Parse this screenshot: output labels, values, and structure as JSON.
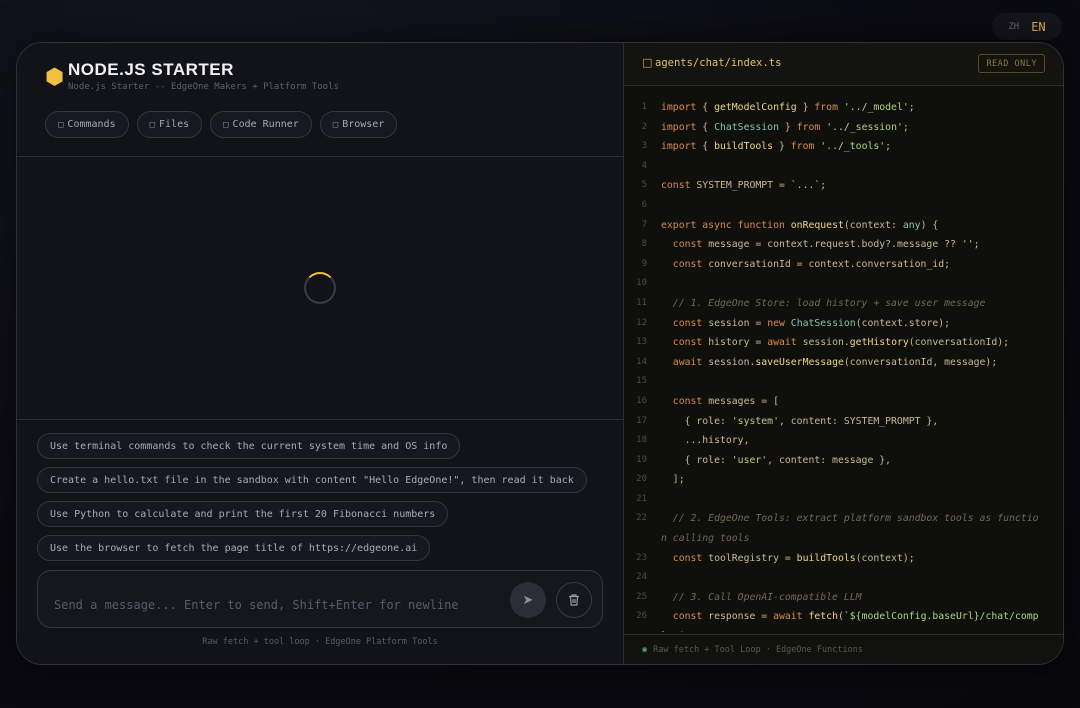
{
  "lang": {
    "zh": "ZH",
    "en": "EN"
  },
  "header": {
    "title": "NODE.JS STARTER",
    "subtitle": "Node.js Starter -- EdgeOne Makers + Platform Tools",
    "tabs": [
      {
        "label": "Commands",
        "icon": "terminal-icon"
      },
      {
        "label": "Files",
        "icon": "file-icon"
      },
      {
        "label": "Code Runner",
        "icon": "code-icon"
      },
      {
        "label": "Browser",
        "icon": "globe-icon"
      }
    ]
  },
  "suggestions": [
    "Use terminal commands to check the current system time and OS info",
    "Create a hello.txt file in the sandbox with content \"Hello EdgeOne!\", then read it back",
    "Use Python to calculate and print the first 20 Fibonacci numbers",
    "Use the browser to fetch the page title of https://edgeone.ai"
  ],
  "input": {
    "placeholder": "Send a message... Enter to send, Shift+Enter for newline",
    "value": ""
  },
  "left_footer": "Raw fetch + tool loop · EdgeOne Platform Tools",
  "code_panel": {
    "file_path": "agents/chat/index.ts",
    "badge": "READ ONLY",
    "footer": "Raw fetch + Tool Loop · EdgeOne Functions",
    "lines": [
      {
        "n": "1",
        "html": "<span class='kw'>import</span> { <span class='fn'>getModelConfig</span> } <span class='kw'>from</span> <span class='str'>'../_model'</span>;"
      },
      {
        "n": "2",
        "html": "<span class='kw'>import</span> { <span class='ty'>ChatSession</span> } <span class='kw'>from</span> <span class='str'>'../_session'</span>;"
      },
      {
        "n": "3",
        "html": "<span class='kw'>import</span> { <span class='fn'>buildTools</span> } <span class='kw'>from</span> <span class='str'>'../_tools'</span>;"
      },
      {
        "n": "4",
        "html": ""
      },
      {
        "n": "5",
        "html": "<span class='kw'>const</span> SYSTEM_PROMPT = <span class='str'>`...`</span>;"
      },
      {
        "n": "6",
        "html": ""
      },
      {
        "n": "7",
        "html": "<span class='kw'>export async function</span> <span class='fn'>onRequest</span>(context: <span class='ty'>any</span>) {"
      },
      {
        "n": "8",
        "html": "  <span class='kw'>const</span> message = context.request.body?.message ?? <span class='str'>''</span>;"
      },
      {
        "n": "9",
        "html": "  <span class='kw'>const</span> conversationId = context.conversation_id;"
      },
      {
        "n": "10",
        "html": ""
      },
      {
        "n": "11",
        "html": "  <span class='cm'>// 1. EdgeOne Store: load history + save user message</span>"
      },
      {
        "n": "12",
        "html": "  <span class='kw'>const</span> session = <span class='kw'>new</span> <span class='ty'>ChatSession</span>(context.store);"
      },
      {
        "n": "13",
        "html": "  <span class='kw'>const</span> history = <span class='kw'>await</span> session.<span class='fn'>getHistory</span>(conversationId);"
      },
      {
        "n": "14",
        "html": "  <span class='kw'>await</span> session.<span class='fn'>saveUserMessage</span>(conversationId, message);"
      },
      {
        "n": "15",
        "html": ""
      },
      {
        "n": "16",
        "html": "  <span class='kw'>const</span> messages = ["
      },
      {
        "n": "17",
        "html": "    { role: <span class='str'>'system'</span>, content: SYSTEM_PROMPT },"
      },
      {
        "n": "18",
        "html": "    ...history,"
      },
      {
        "n": "19",
        "html": "    { role: <span class='str'>'user'</span>, content: message },"
      },
      {
        "n": "20",
        "html": "  ];"
      },
      {
        "n": "21",
        "html": ""
      },
      {
        "n": "22",
        "html": "  <span class='cm'>// 2. EdgeOne Tools: extract platform sandbox tools as function calling tools</span>"
      },
      {
        "n": "23",
        "html": "  <span class='kw'>const</span> toolRegistry = <span class='fn'>buildTools</span>(context);"
      },
      {
        "n": "24",
        "html": ""
      },
      {
        "n": "25",
        "html": "  <span class='cm'>// 3. Call OpenAI-compatible LLM</span>"
      },
      {
        "n": "26",
        "html": "  <span class='kw'>const</span> response = <span class='kw'>await</span> <span class='fn'>fetch</span>(<span class='str'>`${modelConfig.baseUrl}/chat/completi</span>"
      },
      {
        "n": "",
        "html": "  }, {"
      }
    ]
  }
}
